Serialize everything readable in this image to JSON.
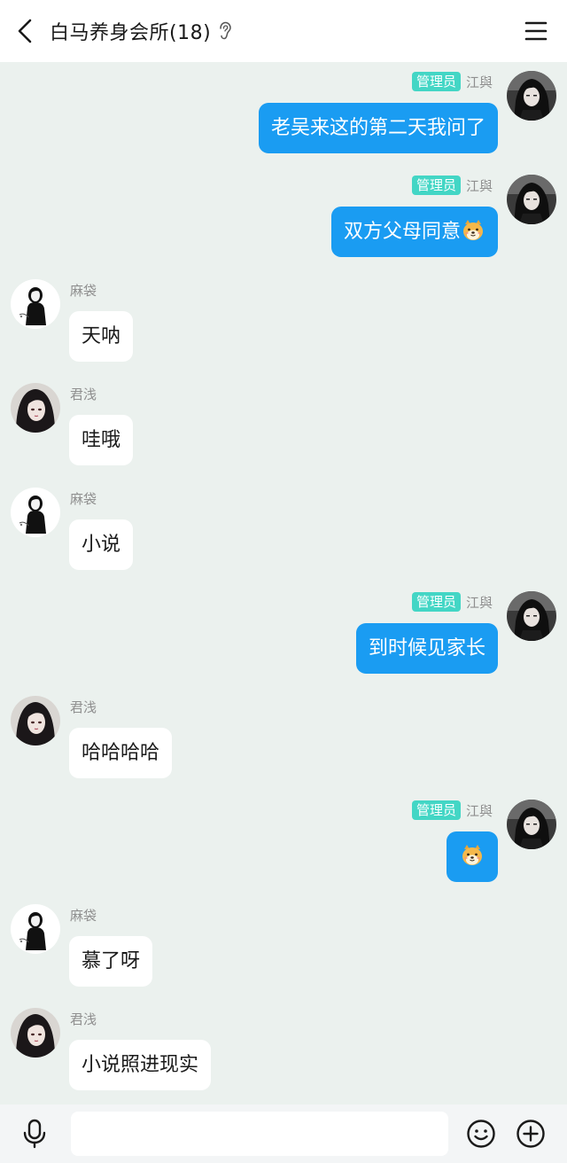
{
  "header": {
    "title": "白马养身会所(18)",
    "back_icon": "chevron-left-icon",
    "status_icon": "ear-icon",
    "menu_icon": "menu-icon"
  },
  "admin_badge": "管理员",
  "colors": {
    "background": "#ebf1ee",
    "self_bubble": "#1a9cf2",
    "other_bubble": "#ffffff",
    "admin_badge": "#43d6c5"
  },
  "messages": [
    {
      "side": "right",
      "sender": "江與",
      "admin": true,
      "text": "老吴来这的第二天我问了"
    },
    {
      "side": "right",
      "sender": "江與",
      "admin": true,
      "text": "双方父母同意",
      "emoji": "dog-face-emoji"
    },
    {
      "side": "left",
      "sender": "麻袋",
      "text": "天呐"
    },
    {
      "side": "left",
      "sender": "君浅",
      "text": "哇哦"
    },
    {
      "side": "left",
      "sender": "麻袋",
      "text": "小说"
    },
    {
      "side": "right",
      "sender": "江與",
      "admin": true,
      "text": "到时候见家长"
    },
    {
      "side": "left",
      "sender": "君浅",
      "text": "哈哈哈哈"
    },
    {
      "side": "right",
      "sender": "江與",
      "admin": true,
      "text": "",
      "emoji": "dog-face-emoji"
    },
    {
      "side": "left",
      "sender": "麻袋",
      "text": "慕了呀"
    },
    {
      "side": "left",
      "sender": "君浅",
      "text": "小说照进现实"
    }
  ],
  "input_bar": {
    "placeholder": "",
    "mic_icon": "microphone-icon",
    "emoji_icon": "smiley-icon",
    "plus_icon": "plus-circle-icon"
  }
}
